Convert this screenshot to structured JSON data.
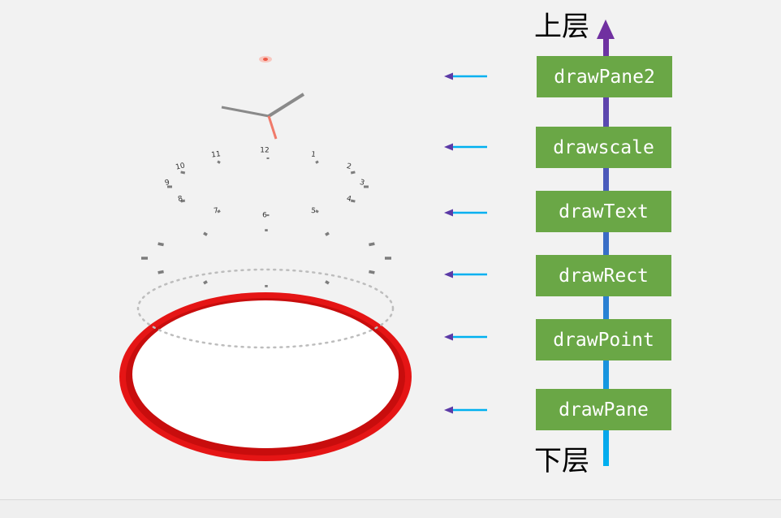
{
  "diagram": {
    "top_label": "上层",
    "bottom_label": "下层",
    "layers": [
      {
        "label": "drawPane2"
      },
      {
        "label": "drawscale"
      },
      {
        "label": "drawText"
      },
      {
        "label": "drawRect"
      },
      {
        "label": "drawPoint"
      },
      {
        "label": "drawPane"
      }
    ],
    "clock_numbers": [
      "1",
      "2",
      "3",
      "4",
      "5",
      "6",
      "7",
      "8",
      "9",
      "10",
      "11",
      "12"
    ],
    "colors": {
      "box": "#6aa746",
      "arrow_top": "#7030a0",
      "arrow_bottom": "#00b0f0",
      "ring": "#e51515",
      "hand_second": "#f07a6a",
      "hand": "#8a8a8a"
    }
  }
}
